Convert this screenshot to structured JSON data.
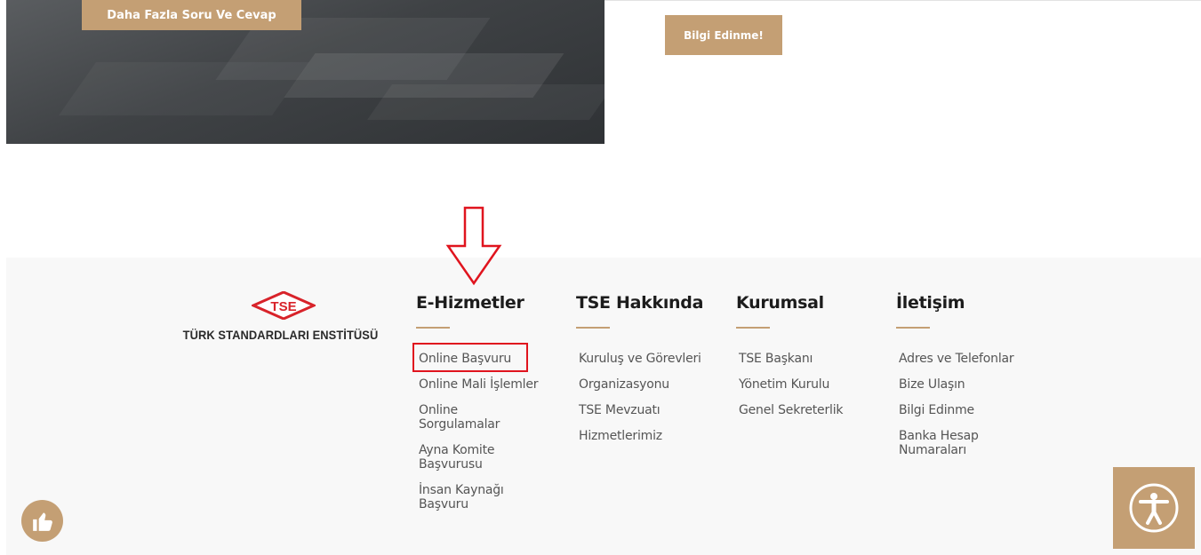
{
  "hero": {
    "qa_button_label": "Daha Fazla Soru Ve Cevap"
  },
  "info_button_label": "Bilgi Edinme!",
  "logo": {
    "mark_text": "TSE",
    "name": "TÜRK STANDARDLARI ENSTİTÜSÜ"
  },
  "footer": {
    "columns": [
      {
        "title": "E-Hizmetler",
        "links": [
          "Online Başvuru",
          "Online Mali İşlemler",
          "Online Sorgulamalar",
          "Ayna Komite Başvurusu",
          "İnsan Kaynağı Başvuru"
        ]
      },
      {
        "title": "TSE Hakkında",
        "links": [
          "Kuruluş ve Görevleri",
          "Organizasyonu",
          "TSE Mevzuatı",
          "Hizmetlerimiz"
        ]
      },
      {
        "title": "Kurumsal",
        "links": [
          "TSE Başkanı",
          "Yönetim Kurulu",
          "Genel Sekreterlik"
        ]
      },
      {
        "title": "İletişim",
        "links": [
          "Adres ve Telefonlar",
          "Bize Ulaşın",
          "Bilgi Edinme",
          "Banka Hesap Numaraları"
        ]
      }
    ]
  },
  "icons": {
    "arrow": "down-arrow-icon",
    "like": "thumbs-up-icon",
    "accessibility": "accessibility-icon"
  },
  "colors": {
    "accent": "#c49f74",
    "highlight": "#e0141e",
    "logo_red": "#d8232a",
    "footer_bg": "#f8f8f8"
  }
}
